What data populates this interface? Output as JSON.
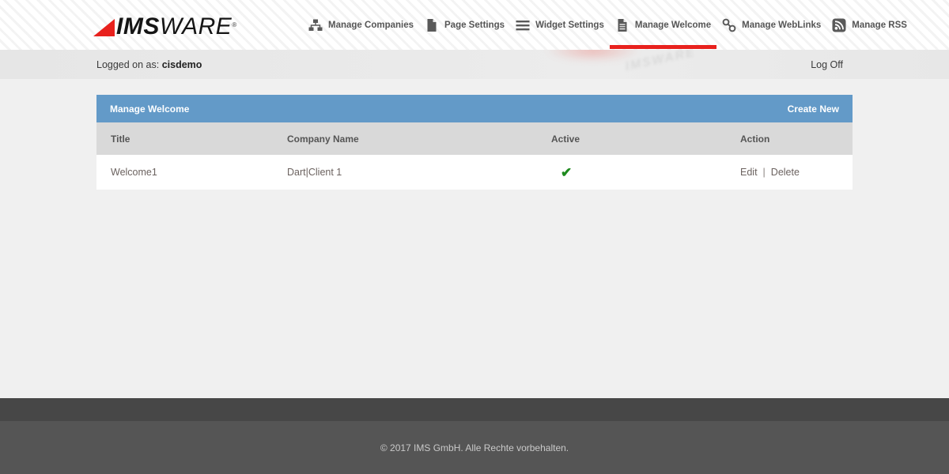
{
  "brand": {
    "name_bold": "IMS",
    "name_light": "WARE",
    "trademark": "®",
    "triangle_color": "#e8211d"
  },
  "nav": {
    "items": [
      {
        "label": "Manage Companies",
        "icon": "sitemap-icon",
        "active": false
      },
      {
        "label": "Page Settings",
        "icon": "page-icon",
        "active": false
      },
      {
        "label": "Widget Settings",
        "icon": "hamburger-icon",
        "active": false
      },
      {
        "label": "Manage Welcome",
        "icon": "document-lines-icon",
        "active": true
      },
      {
        "label": "Manage WebLinks",
        "icon": "link-icon",
        "active": false
      },
      {
        "label": "Manage RSS",
        "icon": "rss-icon",
        "active": false
      }
    ],
    "active_underline_color": "#e8211d"
  },
  "session_bar": {
    "logged_on_prefix": "Logged on as: ",
    "username": "cisdemo",
    "log_off_label": "Log Off",
    "watermark_text": "IMSWARE"
  },
  "panel": {
    "title": "Manage Welcome",
    "create_new_label": "Create New",
    "header_color": "#639ac8"
  },
  "table": {
    "columns": [
      "Title",
      "Company Name",
      "Active",
      "Action"
    ],
    "rows": [
      {
        "title": "Welcome1",
        "company_name": "Dart|Client 1",
        "active": true,
        "active_icon": "✔",
        "actions": [
          "Edit",
          "Delete"
        ],
        "action_separator": "|"
      }
    ]
  },
  "footer": {
    "copyright": "© 2017 IMS GmbH. Alle Rechte vorbehalten."
  },
  "colors": {
    "accent_red": "#e8211d",
    "panel_blue": "#639ac8",
    "check_green": "#1e8a1e",
    "footer_dark": "#474747",
    "footer_main": "#555555"
  }
}
